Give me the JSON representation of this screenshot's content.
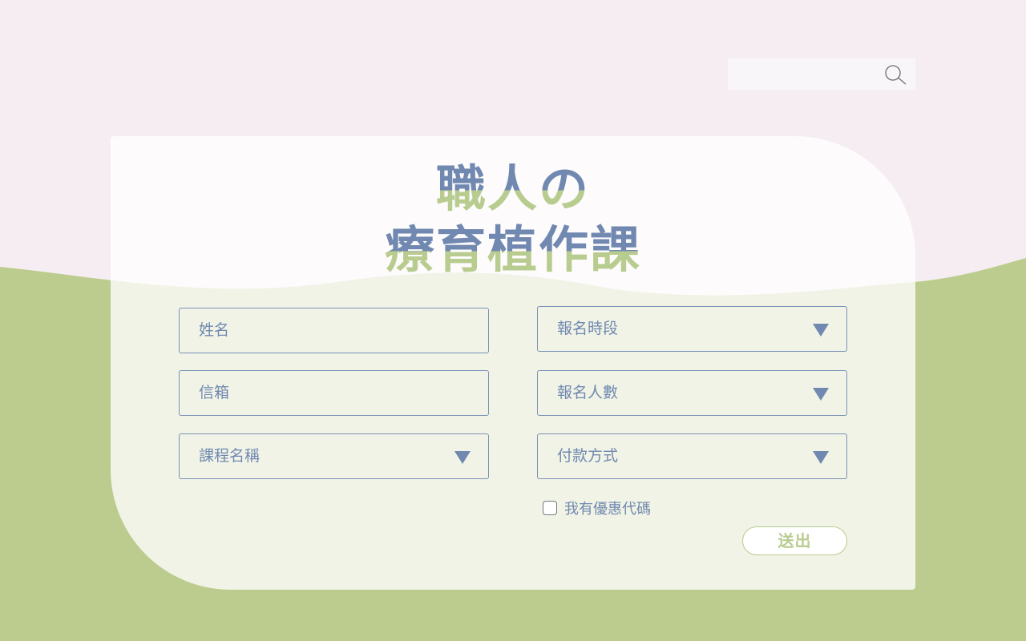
{
  "colors": {
    "background_top": "#f6edf3",
    "background_bottom": "#bccc8e",
    "accent_blue": "#7189b0",
    "accent_green": "#b9cc8f"
  },
  "search": {
    "placeholder": "",
    "icon": "search-icon"
  },
  "title": {
    "line1": "職人の",
    "line2": "療育植作課"
  },
  "form": {
    "left_fields": [
      {
        "label": "姓名",
        "type": "text"
      },
      {
        "label": "信箱",
        "type": "text"
      },
      {
        "label": "課程名稱",
        "type": "select"
      }
    ],
    "right_fields": [
      {
        "label": "報名時段",
        "type": "select"
      },
      {
        "label": "報名人數",
        "type": "select"
      },
      {
        "label": "付款方式",
        "type": "select"
      }
    ],
    "coupon_checkbox": {
      "label": "我有優惠代碼",
      "checked": false
    },
    "submit_label": "送出"
  }
}
